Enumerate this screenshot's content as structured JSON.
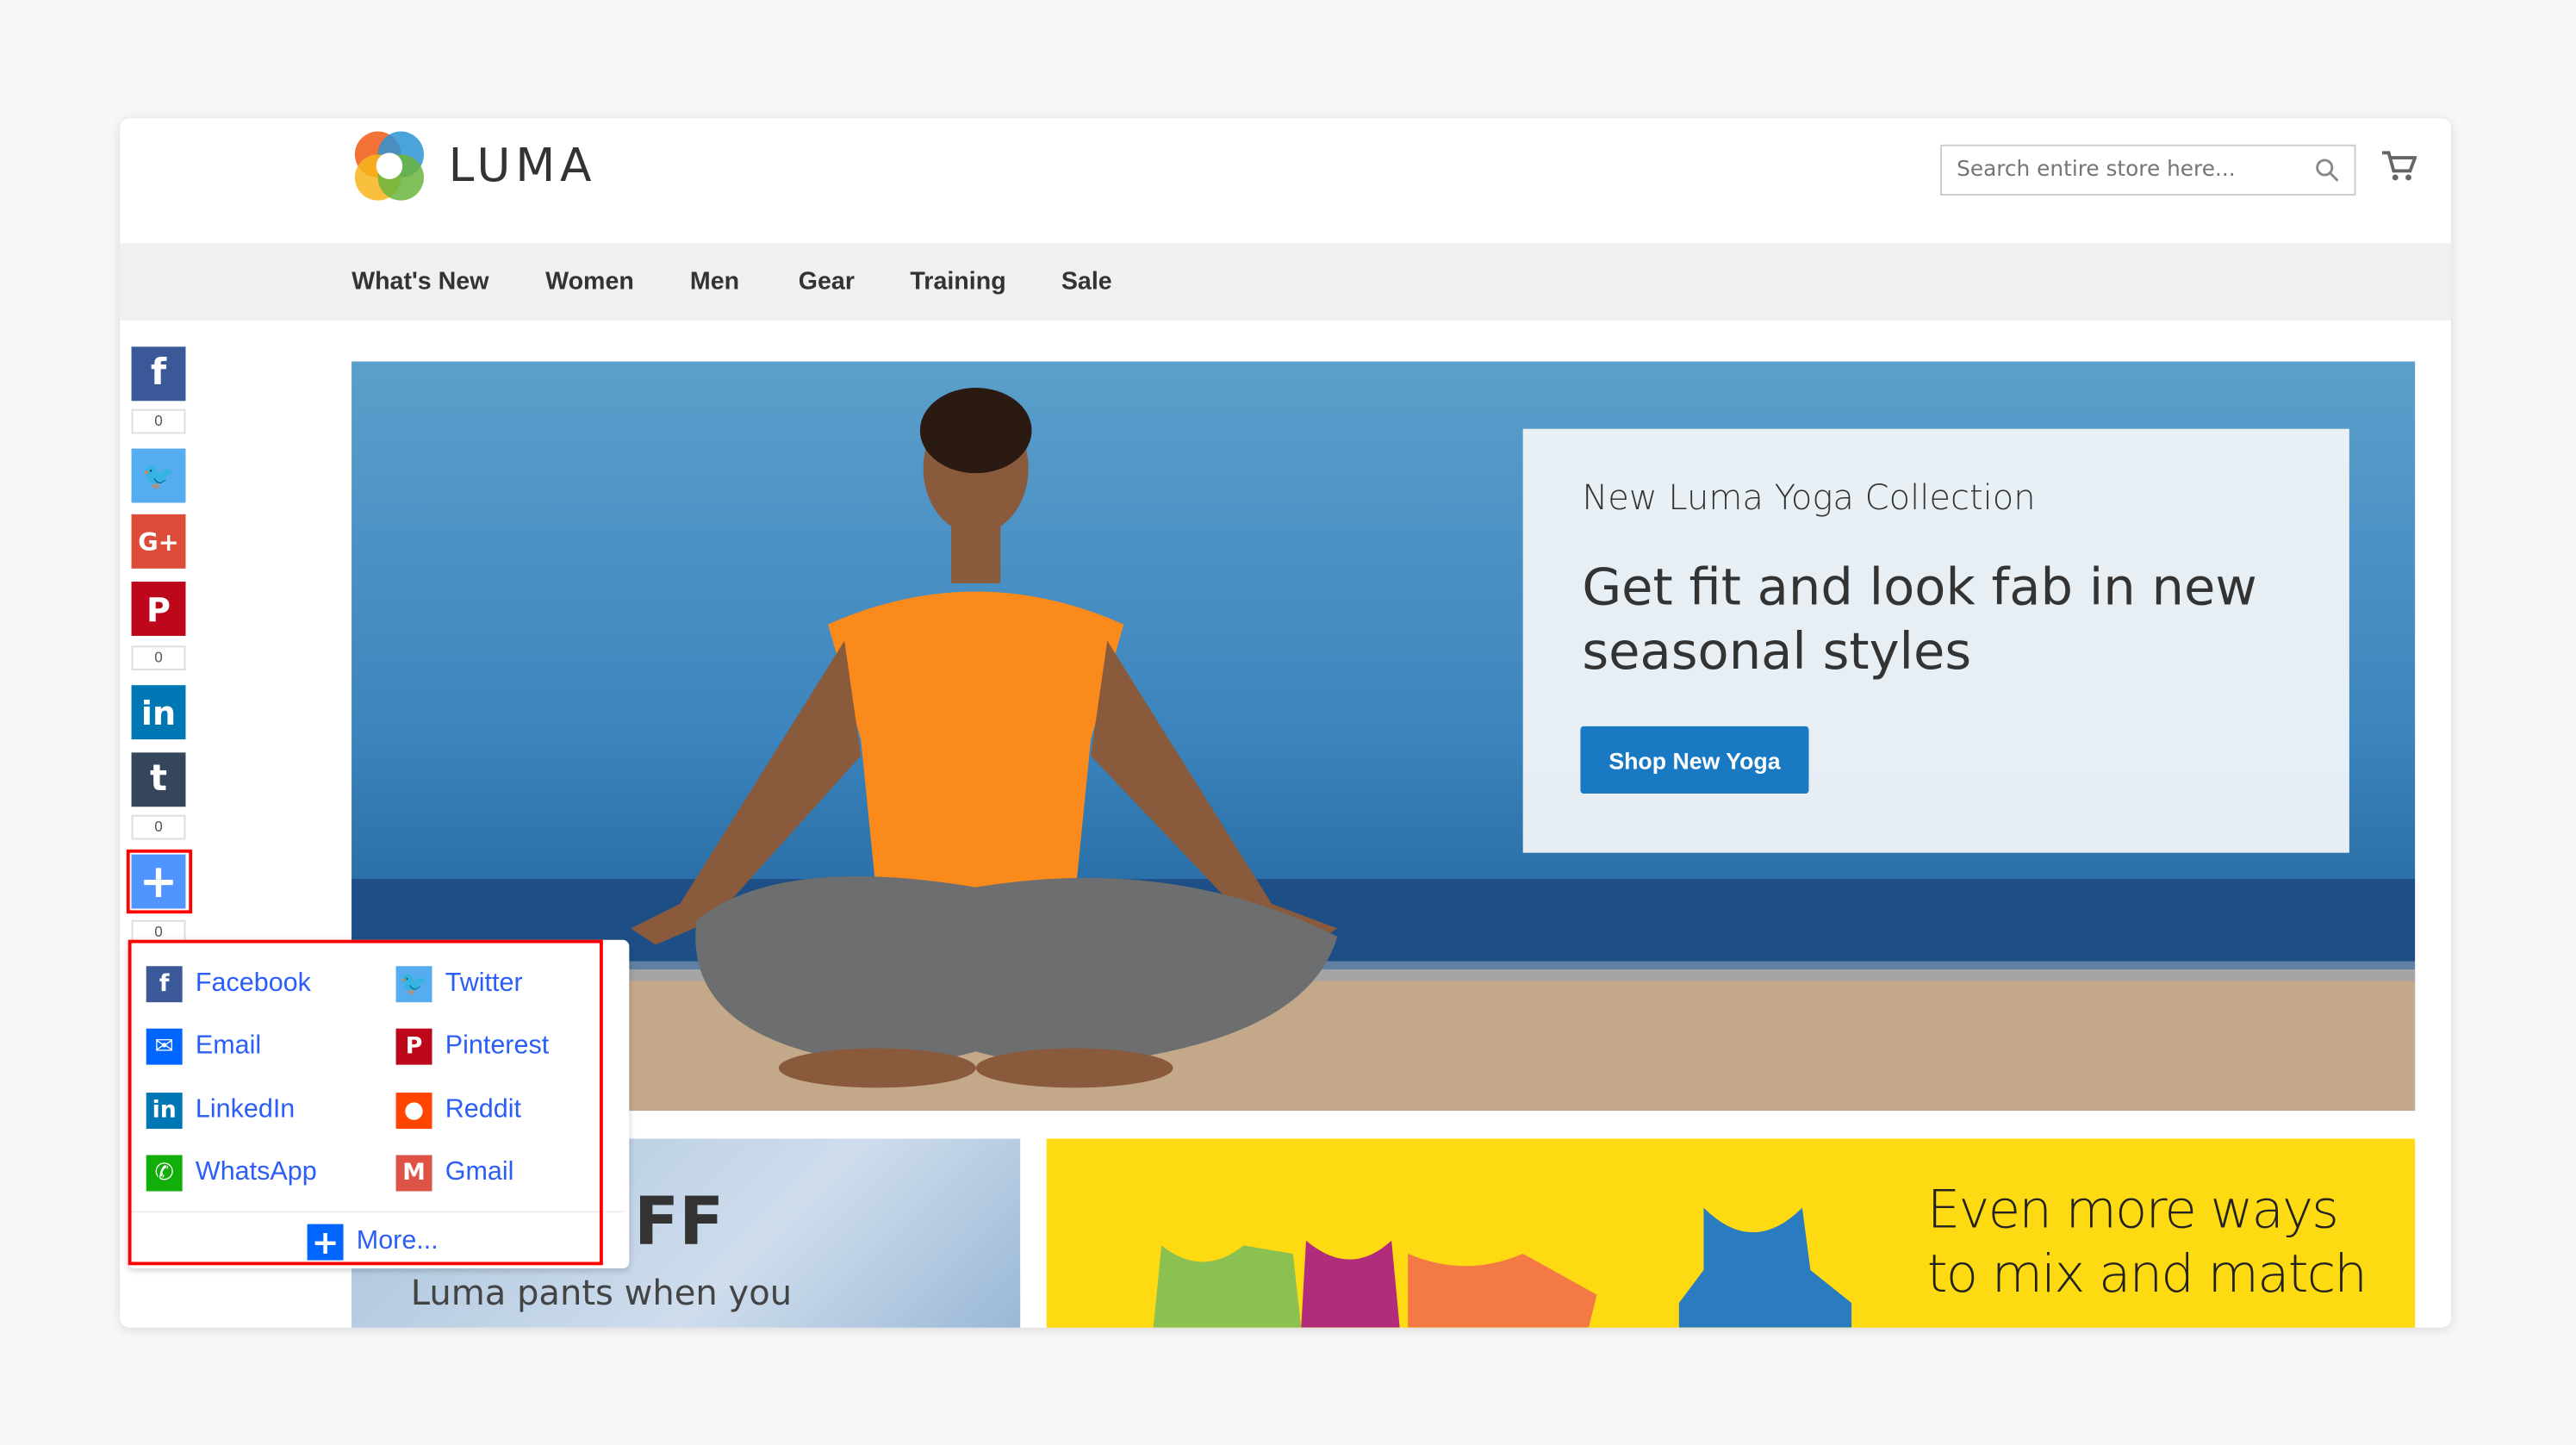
{
  "header": {
    "brand": "LUMA",
    "search_placeholder": "Search entire store here...",
    "cart_icon": "cart-icon"
  },
  "nav": [
    "What's New",
    "Women",
    "Men",
    "Gear",
    "Training",
    "Sale"
  ],
  "hero": {
    "subtitle": "New Luma Yoga Collection",
    "headline_1": "Get fit and look fab in new",
    "headline_2": "seasonal styles",
    "button": "Shop New Yoga",
    "button_color": "#1979c3"
  },
  "panels": {
    "left_heading": "FF",
    "left_text": "Luma pants when you",
    "right_line_1": "Even more ways",
    "right_line_2": "to mix and match",
    "right_color": "#fdda12"
  },
  "share_bar": [
    {
      "name": "facebook",
      "glyph": "f",
      "color": "#3b5998",
      "count": "0"
    },
    {
      "name": "twitter",
      "glyph": "🐦",
      "color": "#55acee"
    },
    {
      "name": "google-plus",
      "glyph": "G+",
      "color": "#dd4b39"
    },
    {
      "name": "pinterest",
      "glyph": "P",
      "color": "#bd081c",
      "count": "0"
    },
    {
      "name": "linkedin",
      "glyph": "in",
      "color": "#0077b5"
    },
    {
      "name": "tumblr",
      "glyph": "t",
      "color": "#35465c",
      "count": "0"
    },
    {
      "name": "more",
      "glyph": "+",
      "color": "#4f94ff",
      "count": "0"
    }
  ],
  "share_menu": {
    "items": [
      {
        "label": "Facebook",
        "glyph": "f",
        "color": "#3b5998"
      },
      {
        "label": "Twitter",
        "glyph": "🐦",
        "color": "#55acee"
      },
      {
        "label": "Email",
        "glyph": "✉",
        "color": "#0166ff"
      },
      {
        "label": "Pinterest",
        "glyph": "P",
        "color": "#bd081c"
      },
      {
        "label": "LinkedIn",
        "glyph": "in",
        "color": "#0077b5"
      },
      {
        "label": "Reddit",
        "glyph": "●",
        "color": "#ff4500"
      },
      {
        "label": "WhatsApp",
        "glyph": "✆",
        "color": "#12af0a"
      },
      {
        "label": "Gmail",
        "glyph": "M",
        "color": "#dd5347"
      }
    ],
    "more": "More..."
  }
}
